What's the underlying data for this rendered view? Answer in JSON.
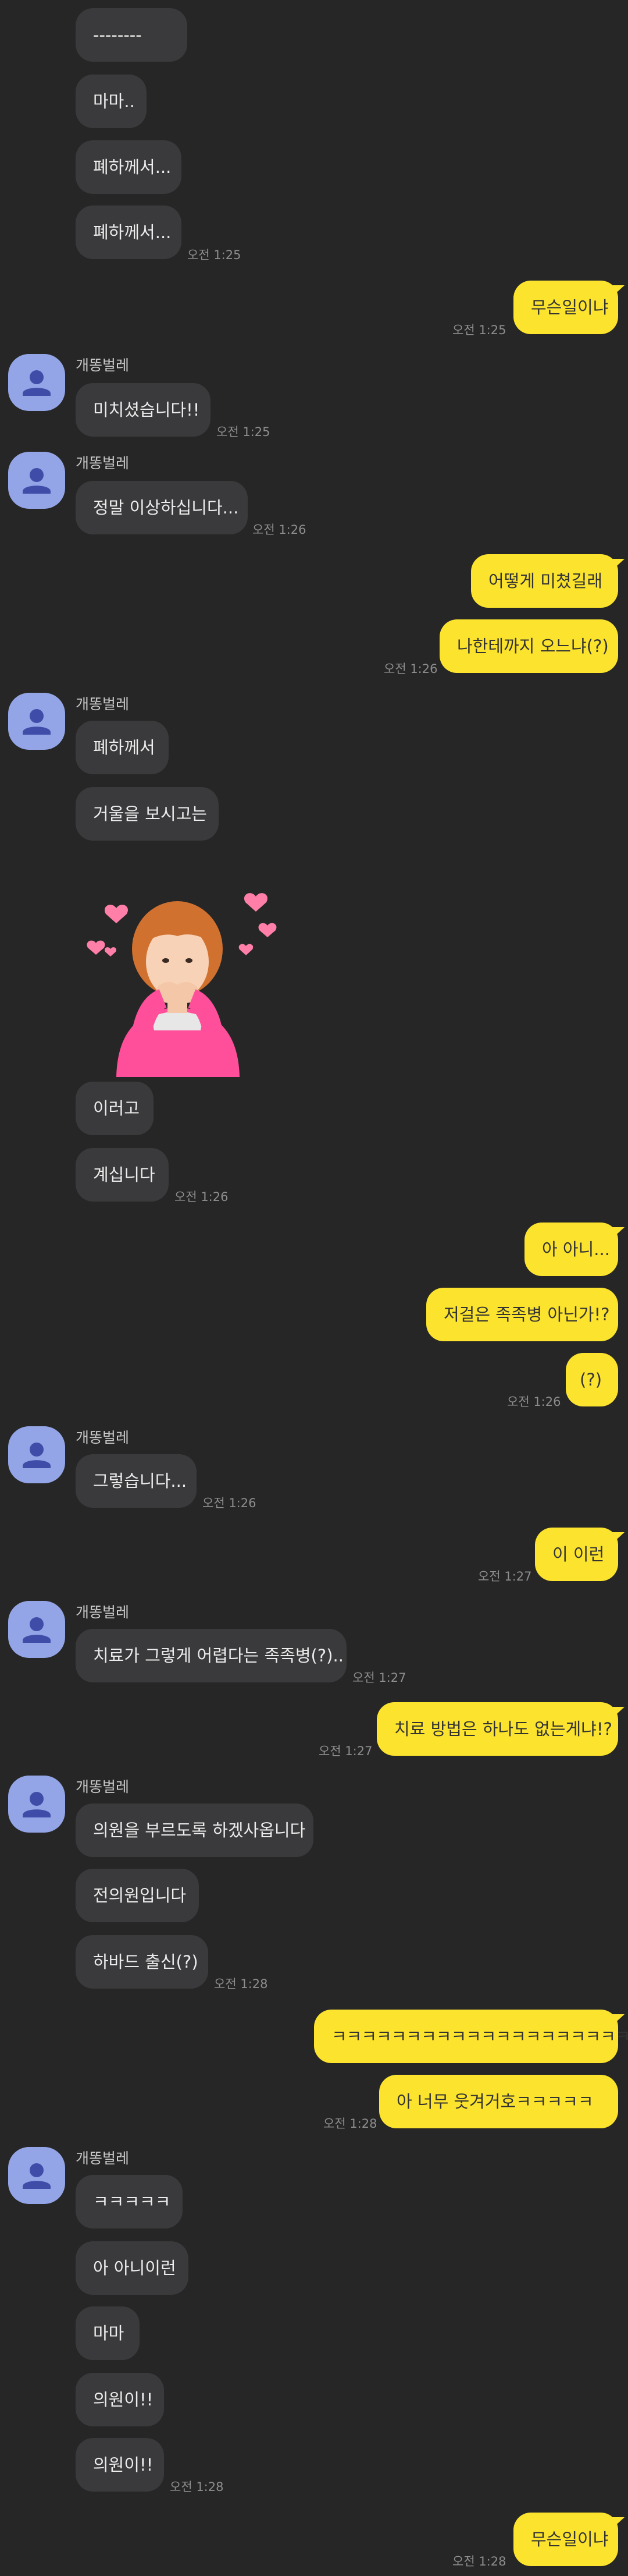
{
  "colors": {
    "background": "#262626",
    "received_bubble": "#3a3a3c",
    "sent_bubble": "#fbe32e",
    "avatar": "#93a5e6"
  },
  "sender": {
    "name": "개똥벌레"
  },
  "messages": {
    "m01": "--------",
    "m02": "마마..",
    "m03": "폐하께서...",
    "m04": "폐하께서...",
    "t01": "오전 1:25",
    "m05": "무슨일이냐",
    "t02": "오전 1:25",
    "m06": "미치셨습니다!!",
    "t03": "오전 1:25",
    "m07": "정말 이상하십니다...",
    "t04": "오전 1:26",
    "m08": "어떻게 미쳤길래",
    "m09": "나한테까지 오느냐(?)",
    "t05": "오전 1:26",
    "m10": "폐하께서",
    "m11": "거울을 보시고는",
    "m12": "이러고",
    "m13": "계십니다",
    "t06": "오전 1:26",
    "m14": "아 아니...",
    "m15": "저걸은 족족병 아닌가!?",
    "m16": "(?)",
    "t07": "오전 1:26",
    "m17": "그렇습니다...",
    "t08": "오전 1:26",
    "m18": "이 이런",
    "t09": "오전 1:27",
    "m19": "치료가 그렇게 어렵다는 족족병(?)..",
    "t10": "오전 1:27",
    "m20": "치료 방법은 하나도 없는게냐!?",
    "t11": "오전 1:27",
    "m21": "의원을 부르도록 하겠사옵니다",
    "m22": "전의원입니다",
    "m23": "하바드 출신(?)",
    "t12": "오전 1:28",
    "m24": "ㅋㅋㅋㅋㅋㅋㅋㅋㅋㅋㅋㅋㅋㅋㅋㅋㅋㅋㅋㅋ",
    "m25": "아 너무 웃겨거호ㅋㅋㅋㅋㅋ",
    "t13": "오전 1:28",
    "m26": "ㅋㅋㅋㅋㅋ",
    "m27": "아 아니이런",
    "m28": "마마",
    "m29": "의원이!!",
    "m30": "의원이!!",
    "t14": "오전 1:28",
    "m31": "무슨일이냐",
    "t15": "오전 1:28"
  },
  "icons": {
    "avatar": "person-silhouette-icon",
    "sticker": "boy-blowing-kiss-with-hearts"
  }
}
